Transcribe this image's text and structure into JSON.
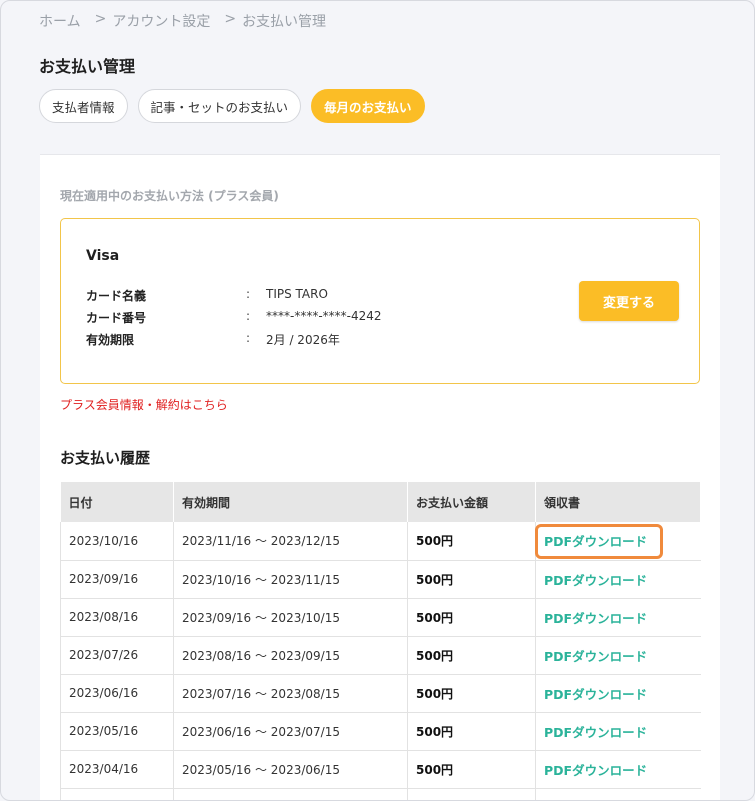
{
  "breadcrumb": {
    "home": "ホーム",
    "account": "アカウント設定",
    "current": "お支払い管理",
    "separator": ">"
  },
  "page_title": "お支払い管理",
  "tabs": [
    {
      "label": "支払者情報"
    },
    {
      "label": "記事・セットのお支払い"
    },
    {
      "label": "毎月のお支払い"
    }
  ],
  "payment_method": {
    "section_label": "現在適用中のお支払い方法 (プラス会員)",
    "brand": "Visa",
    "colon": ":",
    "rows": [
      {
        "label": "カード名義",
        "value": "TIPS TARO"
      },
      {
        "label": "カード番号",
        "value": "****-****-****-4242"
      },
      {
        "label": "有効期限",
        "value": "2月 / 2026年"
      }
    ],
    "change_button": "変更する"
  },
  "plus_link": "プラス会員情報・解約はこちら",
  "history": {
    "title": "お支払い履歴",
    "columns": [
      "日付",
      "有効期間",
      "お支払い金額",
      "領収書"
    ],
    "rows": [
      {
        "date": "2023/10/16",
        "period": "2023/11/16 〜 2023/12/15",
        "amount": "500円",
        "receipt": "PDFダウンロード"
      },
      {
        "date": "2023/09/16",
        "period": "2023/10/16 〜 2023/11/15",
        "amount": "500円",
        "receipt": "PDFダウンロード"
      },
      {
        "date": "2023/08/16",
        "period": "2023/09/16 〜 2023/10/15",
        "amount": "500円",
        "receipt": "PDFダウンロード"
      },
      {
        "date": "2023/07/26",
        "period": "2023/08/16 〜 2023/09/15",
        "amount": "500円",
        "receipt": "PDFダウンロード"
      },
      {
        "date": "2023/06/16",
        "period": "2023/07/16 〜 2023/08/15",
        "amount": "500円",
        "receipt": "PDFダウンロード"
      },
      {
        "date": "2023/05/16",
        "period": "2023/06/16 〜 2023/07/15",
        "amount": "500円",
        "receipt": "PDFダウンロード"
      },
      {
        "date": "2023/04/16",
        "period": "2023/05/16 〜 2023/06/15",
        "amount": "500円",
        "receipt": "PDFダウンロード"
      }
    ]
  },
  "colors": {
    "accent": "#fbbd26",
    "link_green": "#2bb39a",
    "link_red": "#e02020",
    "highlight": "#f08a3c"
  }
}
